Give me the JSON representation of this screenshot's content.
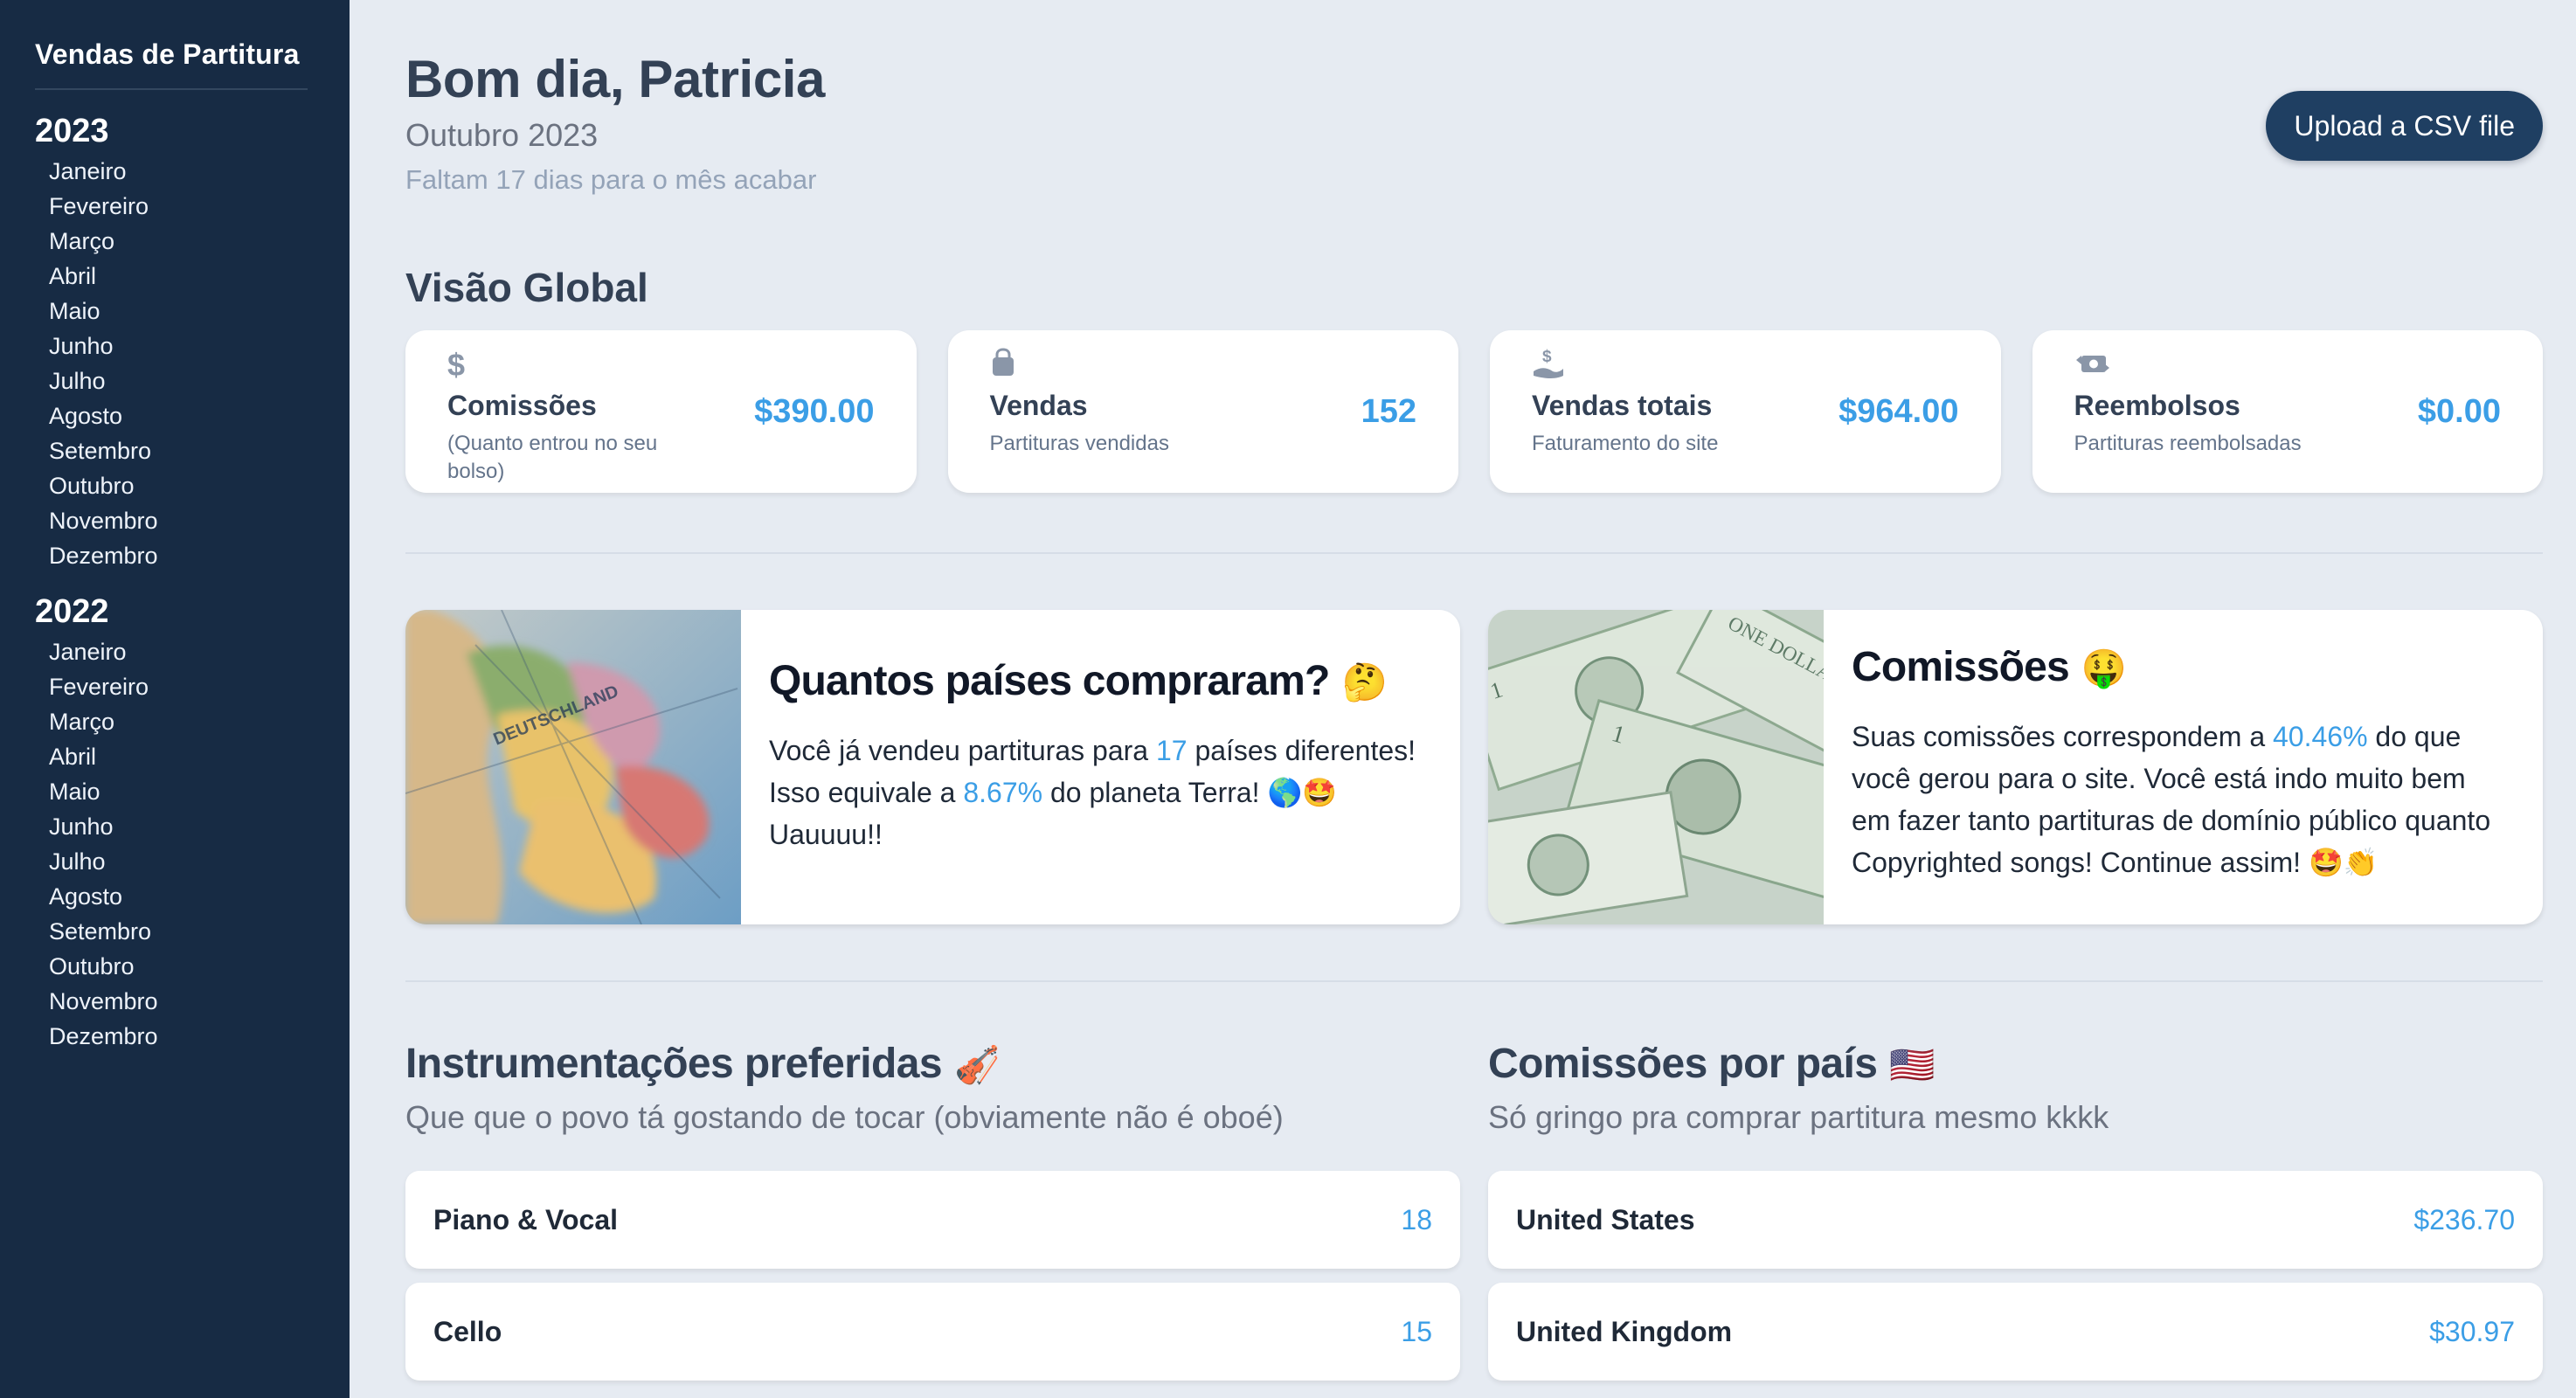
{
  "sidebar": {
    "brand": "Vendas de Partitura",
    "years": [
      {
        "year": "2023",
        "months": [
          "Janeiro",
          "Fevereiro",
          "Março",
          "Abril",
          "Maio",
          "Junho",
          "Julho",
          "Agosto",
          "Setembro",
          "Outubro",
          "Novembro",
          "Dezembro"
        ]
      },
      {
        "year": "2022",
        "months": [
          "Janeiro",
          "Fevereiro",
          "Março",
          "Abril",
          "Maio",
          "Junho",
          "Julho",
          "Agosto",
          "Setembro",
          "Outubro",
          "Novembro",
          "Dezembro"
        ]
      }
    ]
  },
  "header": {
    "greeting": "Bom dia, Patricia",
    "month": "Outubro 2023",
    "days_left": "Faltam 17 dias para o mês acabar",
    "upload_label": "Upload a CSV file"
  },
  "overview": {
    "title": "Visão Global",
    "cards": [
      {
        "icon": "dollar-icon",
        "label": "Comissões",
        "sub": "(Quanto entrou no seu bolso)",
        "value": "$390.00"
      },
      {
        "icon": "shopping-bag-icon",
        "label": "Vendas",
        "sub": "Partituras vendidas",
        "value": "152"
      },
      {
        "icon": "hand-dollar-icon",
        "label": "Vendas totais",
        "sub": "Faturamento do site",
        "value": "$964.00"
      },
      {
        "icon": "refund-icon",
        "label": "Reembolsos",
        "sub": "Partituras reembolsadas",
        "value": "$0.00"
      }
    ]
  },
  "countries_card": {
    "image": "world-map-photo",
    "title": "Quantos países compraram?",
    "emoji": "🤔",
    "text_prefix": "Você já vendeu partituras para ",
    "country_count": "17",
    "text_middle": " países diferentes! Isso equivale a ",
    "planet_percent": "8.67%",
    "text_suffix": " do planeta Terra! 🌎🤩 Uauuuu!!"
  },
  "commission_card": {
    "image": "dollar-bills-photo",
    "title": "Comissões",
    "emoji": "🤑",
    "text_prefix": "Suas comissões correspondem a ",
    "percent": "40.46%",
    "text_suffix": " do que você gerou para o site. Você está indo muito bem em fazer tanto partituras de domínio público quanto Copyrighted songs! Continue assim! 🤩👏"
  },
  "instrumentations": {
    "title": "Instrumentações preferidas",
    "emoji": "🎻",
    "subtitle": "Que que o povo tá gostando de tocar (obviamente não é oboé)",
    "items": [
      {
        "label": "Piano & Vocal",
        "value": "18"
      },
      {
        "label": "Cello",
        "value": "15"
      }
    ]
  },
  "country_commissions": {
    "title": "Comissões por país",
    "emoji": "🇺🇸",
    "subtitle": "Só gringo pra comprar partitura mesmo kkkk",
    "items": [
      {
        "label": "United States",
        "value": "$236.70"
      },
      {
        "label": "United Kingdom",
        "value": "$30.97"
      }
    ]
  }
}
